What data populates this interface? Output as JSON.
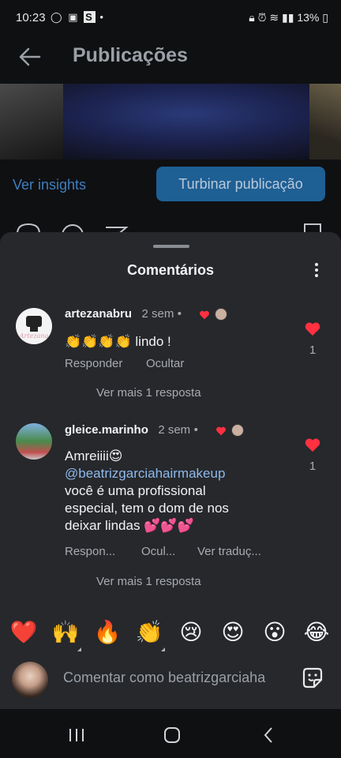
{
  "status_bar": {
    "time": "10:23",
    "left_icons": [
      "whatsapp-icon",
      "gallery-icon",
      "s-app-icon",
      "dot"
    ],
    "battery": "13%"
  },
  "header": {
    "title": "Publicações"
  },
  "post_actions": {
    "insights_label": "Ver insights",
    "boost_label": "Turbinar publicação"
  },
  "comments_sheet": {
    "title": "Comentários",
    "comments": [
      {
        "username": "artezanabru",
        "time": "2 sem",
        "text_emoji": "👏👏👏👏",
        "text": " lindo !",
        "actions": [
          "Responder",
          "Ocultar"
        ],
        "likes": "1",
        "more_replies": "Ver mais 1 resposta"
      },
      {
        "username": "gleice.marinho",
        "time": "2 sem",
        "text_line1": "Amreiiii😍",
        "mention": "@beatrizgarciahairmakeup",
        "text_line3": "você é uma profissional",
        "text_line4": "especial, tem o dom de nos",
        "text_line5": "deixar lindas 💕💕💕",
        "actions": [
          "Respon...",
          "Ocul...",
          "Ver traduç..."
        ],
        "likes": "1",
        "more_replies": "Ver mais 1 resposta"
      }
    ]
  },
  "quick_reactions": [
    "❤️",
    "🙌",
    "🔥",
    "👏",
    "😢",
    "😍",
    "😮",
    "😂"
  ],
  "comment_input": {
    "placeholder": "Comentar como beatrizgarciaha"
  },
  "colors": {
    "accent": "#1e5f94",
    "link": "#3f7fbf",
    "heart": "#ff3040",
    "sheet": "#26282c"
  }
}
